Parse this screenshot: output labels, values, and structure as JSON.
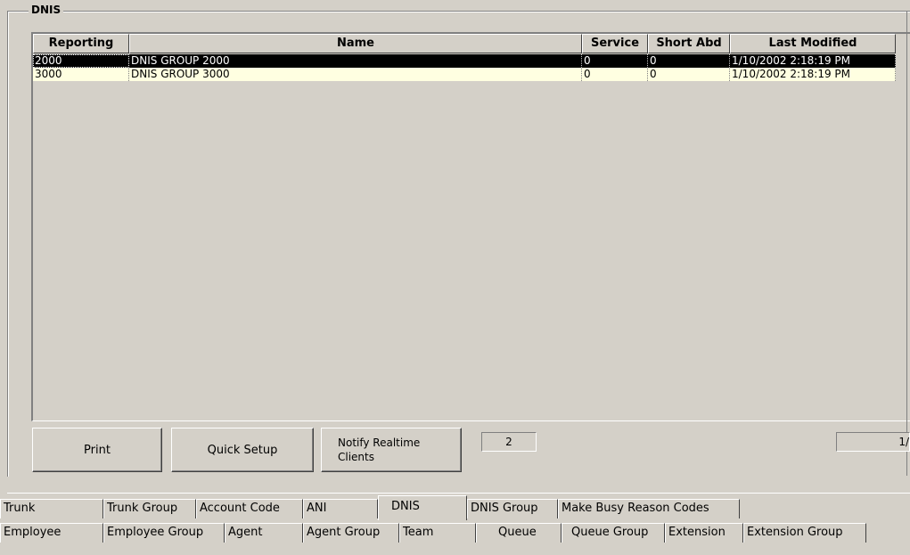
{
  "group": {
    "title": "DNIS"
  },
  "grid": {
    "columns": [
      "Reporting",
      "Name",
      "Service",
      "Short Abd",
      "Last Modified"
    ],
    "rows": [
      [
        "2000",
        "DNIS GROUP 2000",
        "0",
        "0",
        "1/10/2002 2:18:19 PM"
      ],
      [
        "3000",
        "DNIS GROUP 3000",
        "0",
        "0",
        "1/10/2002 2:18:19 PM"
      ]
    ]
  },
  "buttons": {
    "print": "Print",
    "quick_setup": "Quick Setup",
    "notify_line1": "Notify Realtime",
    "notify_line2": "Clients"
  },
  "status": {
    "count": "2",
    "position": "1/"
  },
  "tabs": {
    "row1": [
      "Trunk",
      "Trunk Group",
      "Account Code",
      "ANI",
      "DNIS",
      "DNIS Group",
      "Make Busy Reason Codes"
    ],
    "row2": [
      "Employee",
      "Employee Group",
      "Agent",
      "Agent Group",
      "Team",
      "Queue",
      "Queue Group",
      "Extension",
      "Extension Group"
    ],
    "active": "DNIS"
  },
  "colors": {
    "background": "#d4d0c8",
    "selected_row": "#000000",
    "alt_row": "#ffffe1"
  }
}
